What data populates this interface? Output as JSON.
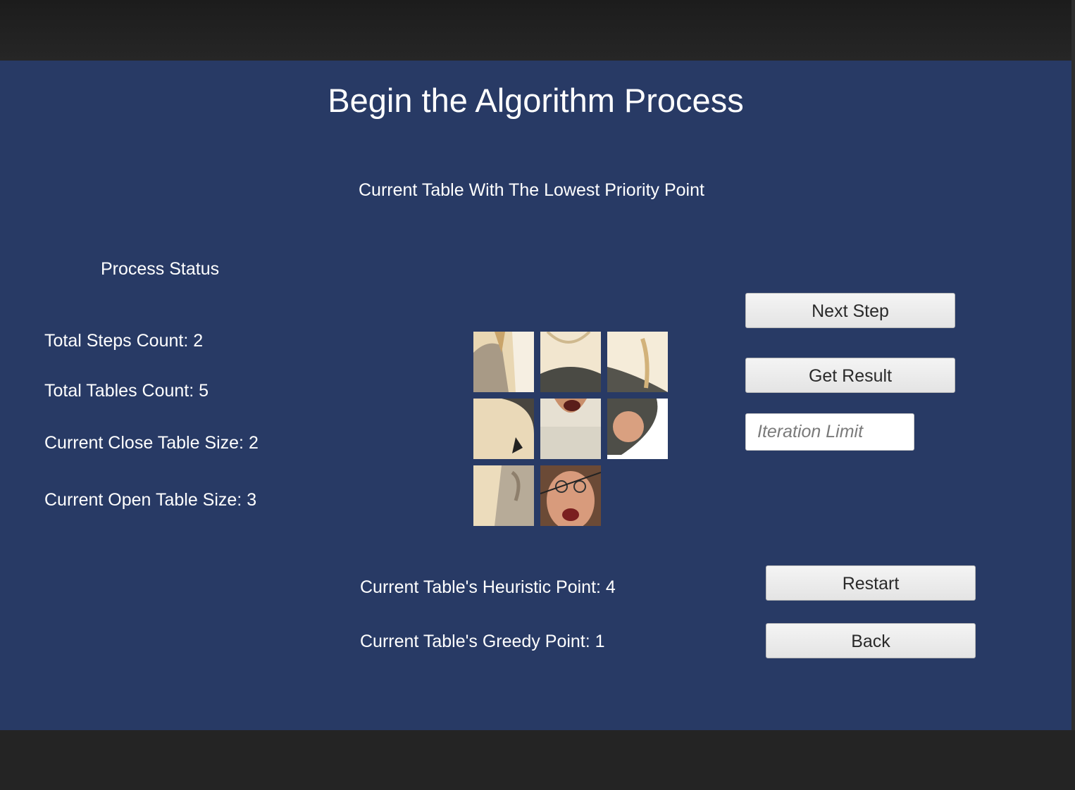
{
  "title": "Begin the Algorithm Process",
  "table_heading": "Current Table With The Lowest Priority Point",
  "status": {
    "heading": "Process Status",
    "total_steps": "Total Steps Count: 2",
    "total_tables": "Total Tables Count: 5",
    "close_table_size": "Current Close Table Size: 2",
    "open_table_size": "Current Open Table Size: 3"
  },
  "points": {
    "heuristic": "Current Table's Heuristic Point: 4",
    "greedy": "Current Table's Greedy Point: 1"
  },
  "buttons": {
    "next_step": "Next Step",
    "get_result": "Get Result",
    "restart": "Restart",
    "back": "Back"
  },
  "iteration_input": {
    "placeholder": "Iteration Limit",
    "value": ""
  },
  "puzzle": {
    "tiles": [
      "tile-1",
      "tile-2",
      "tile-3",
      "tile-4",
      "tile-5",
      "tile-6",
      "tile-7",
      "tile-8",
      "empty"
    ]
  },
  "colors": {
    "panel": "#283a65",
    "frame": "#232323",
    "text": "#ffffff",
    "button": "#eeeeee"
  }
}
